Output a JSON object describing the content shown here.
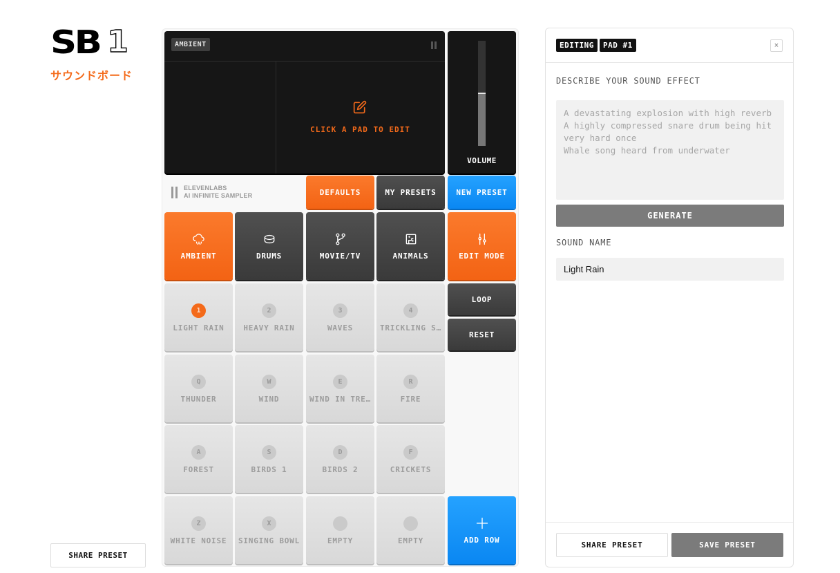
{
  "brand": {
    "logo_main": "SB",
    "logo_num": "1",
    "subtitle": "サウンドボード"
  },
  "left": {
    "share_label": "SHARE PRESET"
  },
  "screen": {
    "tag": "AMBIENT",
    "edit_prompt": "CLICK A PAD TO EDIT",
    "icon": "edit-icon"
  },
  "volume": {
    "label": "VOLUME",
    "level": 0.5
  },
  "maker": {
    "line1": "ELEVENLABS",
    "line2": "AI INFINITE SAMPLER"
  },
  "top_buttons": {
    "defaults": "DEFAULTS",
    "my_presets": "MY PRESETS",
    "new_preset": "NEW PRESET"
  },
  "categories": [
    {
      "label": "AMBIENT",
      "icon": "cloud-rain-icon",
      "active": true
    },
    {
      "label": "DRUMS",
      "icon": "drum-icon",
      "active": false
    },
    {
      "label": "MOVIE/TV",
      "icon": "git-branch-icon",
      "active": false
    },
    {
      "label": "ANIMALS",
      "icon": "animal-icon",
      "active": false
    }
  ],
  "side_buttons": {
    "edit_mode": "EDIT MODE",
    "loop": "LOOP",
    "reset": "RESET",
    "add_row": "ADD ROW"
  },
  "pads": [
    {
      "key": "1",
      "name": "LIGHT RAIN",
      "active": true
    },
    {
      "key": "2",
      "name": "HEAVY RAIN"
    },
    {
      "key": "3",
      "name": "WAVES"
    },
    {
      "key": "4",
      "name": "TRICKLING S…"
    },
    {
      "key": "Q",
      "name": "THUNDER"
    },
    {
      "key": "W",
      "name": "WIND"
    },
    {
      "key": "E",
      "name": "WIND IN TRE…"
    },
    {
      "key": "R",
      "name": "FIRE"
    },
    {
      "key": "A",
      "name": "FOREST"
    },
    {
      "key": "S",
      "name": "BIRDS 1"
    },
    {
      "key": "D",
      "name": "BIRDS 2"
    },
    {
      "key": "F",
      "name": "CRICKETS"
    },
    {
      "key": "Z",
      "name": "WHITE NOISE"
    },
    {
      "key": "X",
      "name": "SINGING BOWL"
    },
    {
      "key": "",
      "name": "EMPTY"
    },
    {
      "key": "",
      "name": "EMPTY"
    }
  ],
  "panel": {
    "badge_editing": "EDITING",
    "badge_pad": "PAD #1",
    "close_glyph": "×",
    "describe_label": "DESCRIBE YOUR SOUND EFFECT",
    "describe_placeholder": "A devastating explosion with high reverb\nA highly compressed snare drum being hit very hard once\nWhale song heard from underwater",
    "describe_value": "",
    "generate_label": "GENERATE",
    "sound_name_label": "SOUND NAME",
    "sound_name_value": "Light Rain",
    "share_label": "SHARE PRESET",
    "save_label": "SAVE PRESET"
  },
  "colors": {
    "accent": "#f46a1a",
    "blue": "#0a87f2",
    "dark": "#3a3a3a"
  }
}
